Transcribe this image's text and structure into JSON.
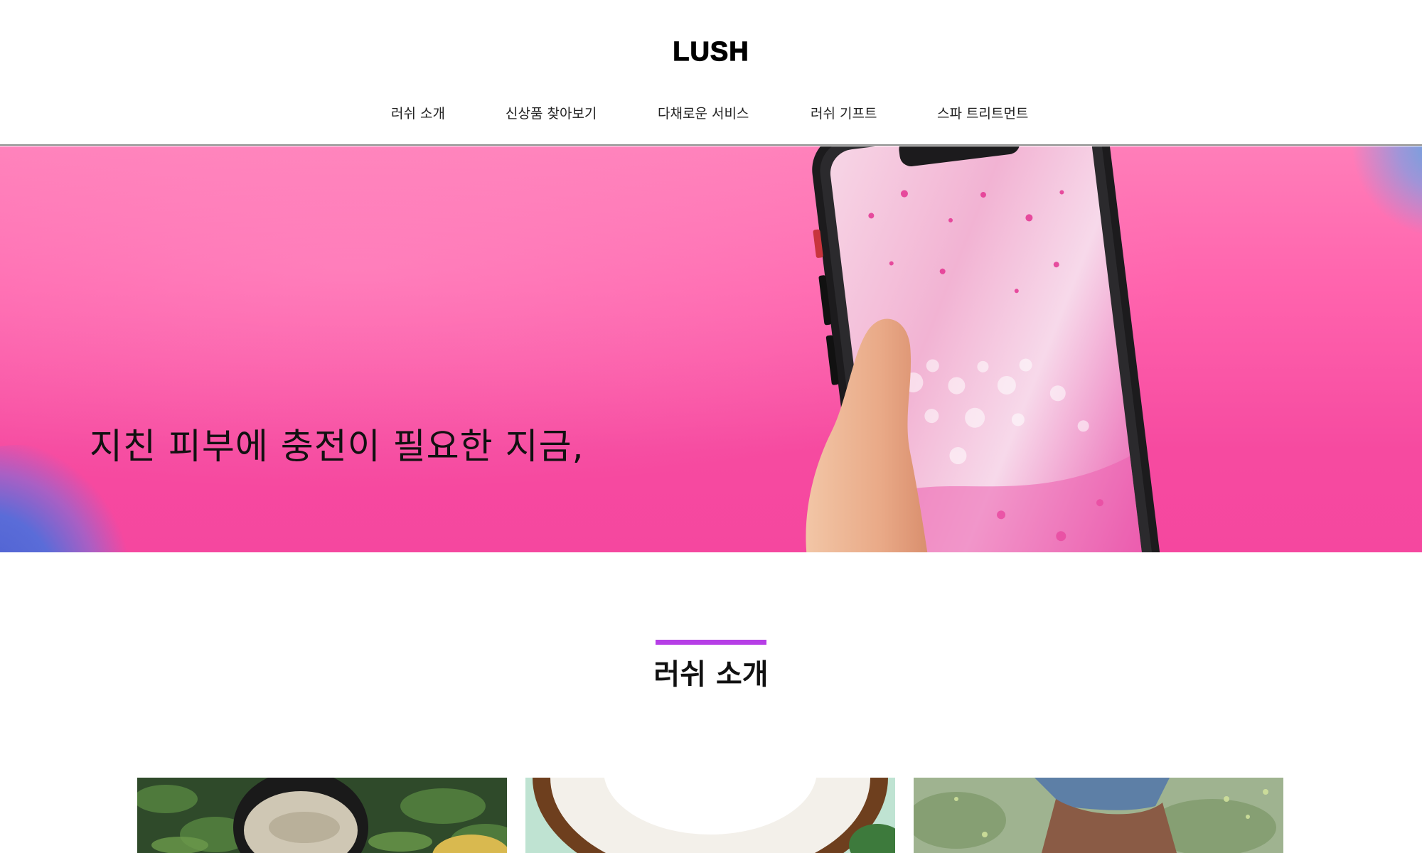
{
  "header": {
    "logo": "LUSH"
  },
  "nav": {
    "items": [
      {
        "label": "러쉬 소개"
      },
      {
        "label": "신상품 찾아보기"
      },
      {
        "label": "다채로운 서비스"
      },
      {
        "label": "러쉬 기프트"
      },
      {
        "label": "스파 트리트먼트"
      }
    ]
  },
  "hero": {
    "headline": "지친 피부에 충전이 필요한 지금,",
    "background_color": "#f64aa0"
  },
  "section": {
    "title": "러쉬 소개",
    "accent_color": "#b63ee6"
  },
  "cards": [
    {
      "image": "green-clay-mask-jar-in-leaves"
    },
    {
      "image": "split-coconut"
    },
    {
      "image": "hand-in-green-field"
    }
  ]
}
